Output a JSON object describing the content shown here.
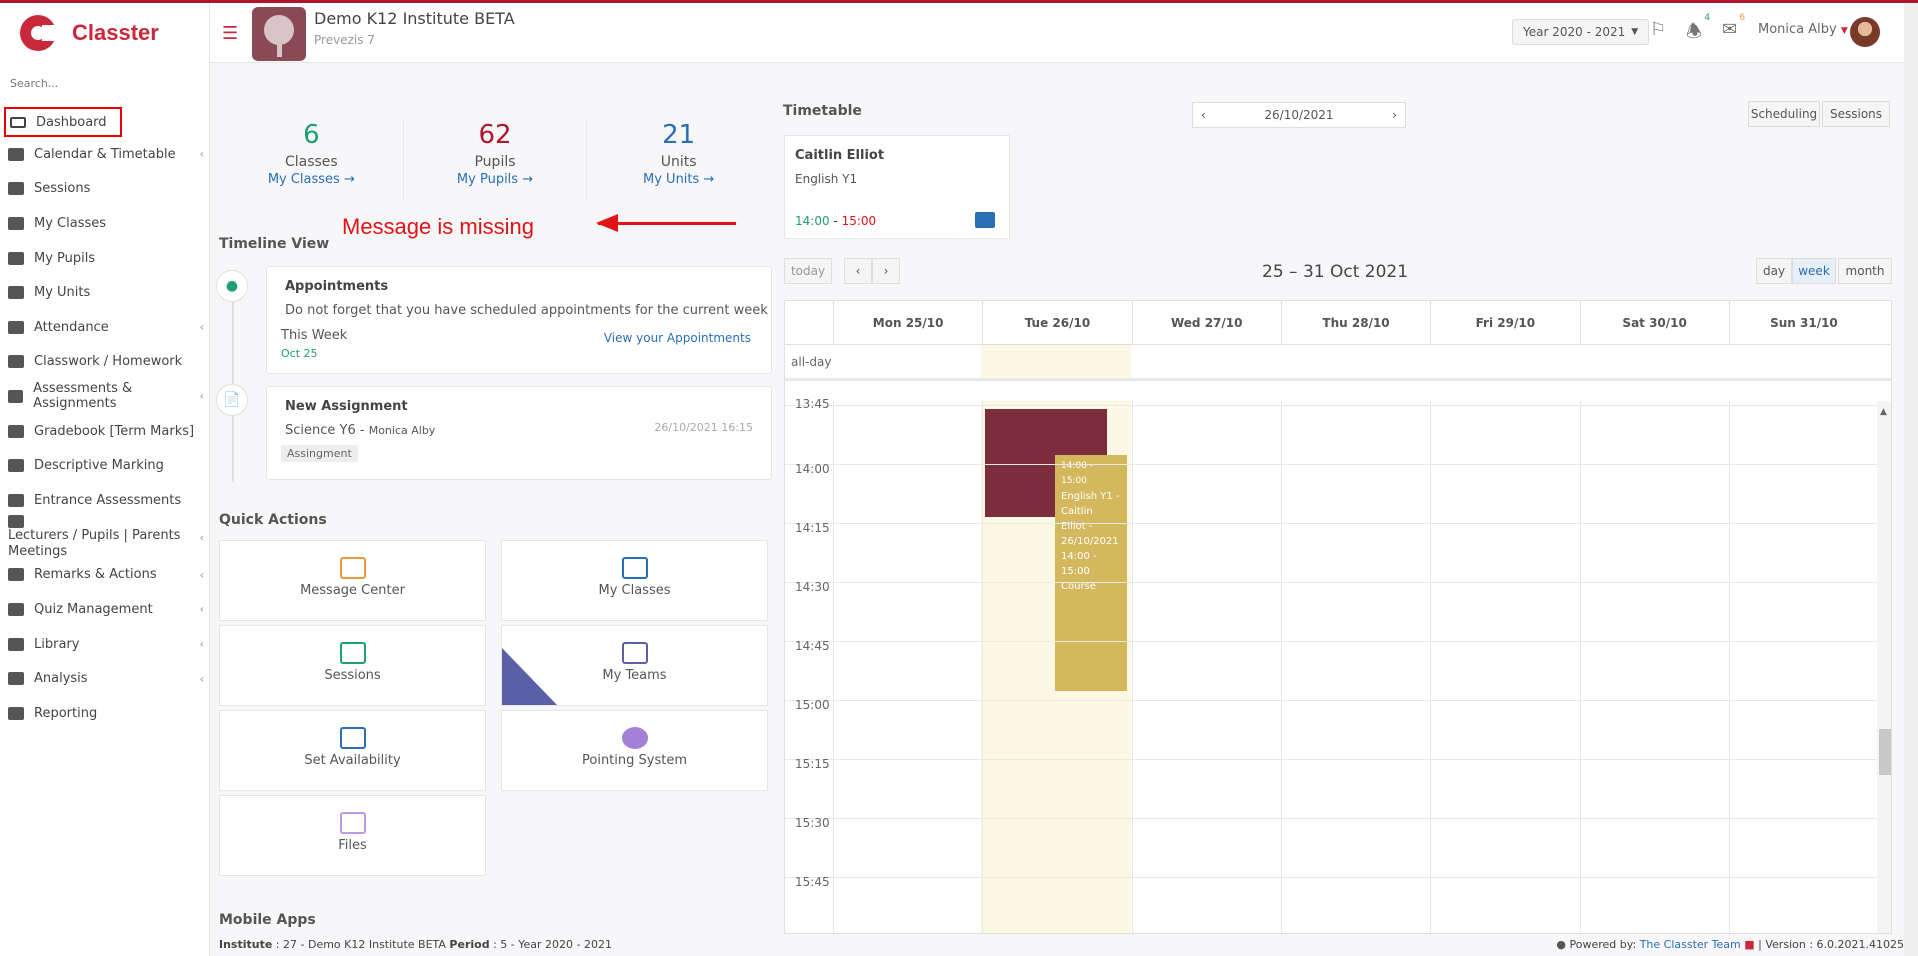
{
  "sidebar": {
    "brand": "Classter",
    "search_placeholder": "Search...",
    "items": [
      {
        "label": "Dashboard",
        "icon": "monitor-icon",
        "active": true
      },
      {
        "label": "Calendar & Timetable",
        "icon": "calendar-icon",
        "chev": true
      },
      {
        "label": "Sessions",
        "icon": "presentation-icon"
      },
      {
        "label": "My Classes",
        "icon": "group-icon"
      },
      {
        "label": "My Pupils",
        "icon": "users-icon"
      },
      {
        "label": "My Units",
        "icon": "book-icon"
      },
      {
        "label": "Attendance",
        "icon": "user-check-icon",
        "chev": true
      },
      {
        "label": "Classwork / Homework",
        "icon": "list-icon"
      },
      {
        "label": "Assessments & Assignments",
        "icon": "edit-icon",
        "chev": true
      },
      {
        "label": "Gradebook [Term Marks]",
        "icon": "gradebook-icon"
      },
      {
        "label": "Descriptive Marking",
        "icon": "marking-icon"
      },
      {
        "label": "Entrance Assessments",
        "icon": "user-icon"
      },
      {
        "label": "Lecturers / Pupils | Parents Meetings",
        "icon": "meeting-icon",
        "chev": true
      },
      {
        "label": "Remarks & Actions",
        "icon": "shuffle-icon",
        "chev": true
      },
      {
        "label": "Quiz Management",
        "icon": "quiz-icon",
        "chev": true
      },
      {
        "label": "Library",
        "icon": "library-icon",
        "chev": true
      },
      {
        "label": "Analysis",
        "icon": "chart-icon",
        "chev": true
      },
      {
        "label": "Reporting",
        "icon": "printer-icon"
      }
    ]
  },
  "header": {
    "institute_name": "Demo K12 Institute BETA",
    "institute_sub": "Prevezis 7",
    "year": "Year 2020 - 2021",
    "notifications_count": "4",
    "messages_count": "6",
    "user_name": "Monica Alby"
  },
  "stats": [
    {
      "value": "6",
      "label": "Classes",
      "link": "My Classes →",
      "color": "#1d9e73"
    },
    {
      "value": "62",
      "label": "Pupils",
      "link": "My Pupils →",
      "color": "#b0152b"
    },
    {
      "value": "21",
      "label": "Units",
      "link": "My Units →",
      "color": "#2a6fb5"
    }
  ],
  "annotation": "Message is missing",
  "timeline": {
    "title": "Timeline View",
    "appointments": {
      "title": "Appointments",
      "text": "Do not forget that you have scheduled appointments for the current week",
      "period": "This Week",
      "date": "Oct 25",
      "link": "View your Appointments"
    },
    "assignment": {
      "title": "New Assignment",
      "subject": "Science Y6 - ",
      "teacher": "Monica Alby",
      "datetime": "26/10/2021 16:15",
      "tag": "Assingment"
    }
  },
  "quick_actions": {
    "title": "Quick Actions",
    "items": [
      "Message Center",
      "My Classes",
      "Sessions",
      "My Teams",
      "Set Availability",
      "Pointing System",
      "Files"
    ]
  },
  "mobile_apps_title": "Mobile Apps",
  "timetable": {
    "title": "Timetable",
    "date": "26/10/2021",
    "scheduling_btn": "Scheduling",
    "sessions_btn": "Sessions",
    "card": {
      "teacher": "Caitlin Elliot",
      "course": "English Y1",
      "start": "14:00",
      "sep": " - ",
      "end": "15:00"
    }
  },
  "calendar": {
    "today_btn": "today",
    "range_title": "25 – 31 Oct 2021",
    "views": [
      "day",
      "week",
      "month"
    ],
    "active_view": "week",
    "days": [
      "Mon 25/10",
      "Tue 26/10",
      "Wed 27/10",
      "Thu 28/10",
      "Fri 29/10",
      "Sat 30/10",
      "Sun 31/10"
    ],
    "allday_label": "all-day",
    "times": [
      "13:45",
      "14:00",
      "14:15",
      "14:30",
      "14:45",
      "15:00",
      "15:15",
      "15:30",
      "15:45"
    ],
    "event_text": [
      "14:00 - 15:00",
      "English Y1 -",
      "Caitlin",
      "Elliot -",
      "26/10/2021",
      "14:00 -",
      "15:00",
      "Course"
    ]
  },
  "footer": {
    "institute_label": "Institute",
    "institute_value": " : 27 - Demo K12 Institute BETA ",
    "period_label": "Period",
    "period_value": " : 5 - Year 2020 - 2021",
    "powered_prefix": "Powered by: ",
    "powered_link": "The Classter Team",
    "version": " | Version : 6.0.2021.41025"
  }
}
